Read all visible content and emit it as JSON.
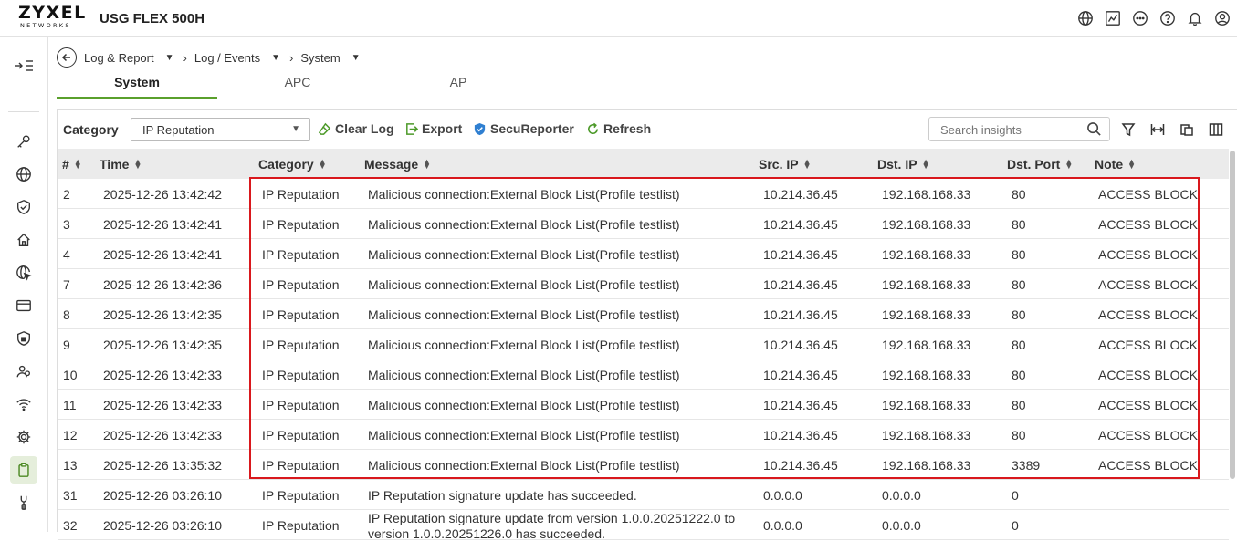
{
  "app": {
    "logo_main": "ZYXEL",
    "logo_sub": "NETWORKS",
    "device_name": "USG FLEX 500H"
  },
  "top_icons": [
    "globe-icon",
    "chart-icon",
    "more-icon",
    "help-icon",
    "bell-icon",
    "user-icon"
  ],
  "sidebar": {
    "items": [
      "key-icon",
      "globe-icon",
      "shield-check-icon",
      "cloud-home-icon",
      "globe-cursor-icon",
      "card-icon",
      "shield-lock-icon",
      "users-icon",
      "wifi-icon",
      "gear-icon",
      "clipboard-icon",
      "wrench-icon"
    ],
    "active": "clipboard-icon"
  },
  "breadcrumb": {
    "items": [
      "Log & Report",
      "Log / Events",
      "System"
    ]
  },
  "tabs": [
    {
      "label": "System",
      "active": true
    },
    {
      "label": "APC",
      "active": false
    },
    {
      "label": "AP",
      "active": false
    }
  ],
  "toolbar": {
    "category_label": "Category",
    "category_value": "IP Reputation",
    "clear_log": "Clear Log",
    "export": "Export",
    "secureporter": "SecuReporter",
    "refresh": "Refresh",
    "search_placeholder": "Search insights",
    "accent_color": "#5aa02c"
  },
  "table": {
    "headers": [
      "#",
      "Time",
      "Category",
      "Message",
      "Src. IP",
      "Dst. IP",
      "Dst. Port",
      "Note"
    ],
    "rows": [
      [
        "2",
        "2025-12-26 13:42:42",
        "IP Reputation",
        "Malicious connection:External Block List(Profile testlist)",
        "10.214.36.45",
        "192.168.168.33",
        "80",
        "ACCESS BLOCK"
      ],
      [
        "3",
        "2025-12-26 13:42:41",
        "IP Reputation",
        "Malicious connection:External Block List(Profile testlist)",
        "10.214.36.45",
        "192.168.168.33",
        "80",
        "ACCESS BLOCK"
      ],
      [
        "4",
        "2025-12-26 13:42:41",
        "IP Reputation",
        "Malicious connection:External Block List(Profile testlist)",
        "10.214.36.45",
        "192.168.168.33",
        "80",
        "ACCESS BLOCK"
      ],
      [
        "7",
        "2025-12-26 13:42:36",
        "IP Reputation",
        "Malicious connection:External Block List(Profile testlist)",
        "10.214.36.45",
        "192.168.168.33",
        "80",
        "ACCESS BLOCK"
      ],
      [
        "8",
        "2025-12-26 13:42:35",
        "IP Reputation",
        "Malicious connection:External Block List(Profile testlist)",
        "10.214.36.45",
        "192.168.168.33",
        "80",
        "ACCESS BLOCK"
      ],
      [
        "9",
        "2025-12-26 13:42:35",
        "IP Reputation",
        "Malicious connection:External Block List(Profile testlist)",
        "10.214.36.45",
        "192.168.168.33",
        "80",
        "ACCESS BLOCK"
      ],
      [
        "10",
        "2025-12-26 13:42:33",
        "IP Reputation",
        "Malicious connection:External Block List(Profile testlist)",
        "10.214.36.45",
        "192.168.168.33",
        "80",
        "ACCESS BLOCK"
      ],
      [
        "11",
        "2025-12-26 13:42:33",
        "IP Reputation",
        "Malicious connection:External Block List(Profile testlist)",
        "10.214.36.45",
        "192.168.168.33",
        "80",
        "ACCESS BLOCK"
      ],
      [
        "12",
        "2025-12-26 13:42:33",
        "IP Reputation",
        "Malicious connection:External Block List(Profile testlist)",
        "10.214.36.45",
        "192.168.168.33",
        "80",
        "ACCESS BLOCK"
      ],
      [
        "13",
        "2025-12-26 13:35:32",
        "IP Reputation",
        "Malicious connection:External Block List(Profile testlist)",
        "10.214.36.45",
        "192.168.168.33",
        "3389",
        "ACCESS BLOCK"
      ],
      [
        "31",
        "2025-12-26 03:26:10",
        "IP Reputation",
        "IP Reputation signature update has succeeded.",
        "0.0.0.0",
        "0.0.0.0",
        "0",
        ""
      ],
      [
        "32",
        "2025-12-26 03:26:10",
        "IP Reputation",
        "IP Reputation signature update from version 1.0.0.20251222.0 to version 1.0.0.20251226.0 has succeeded.",
        "0.0.0.0",
        "0.0.0.0",
        "0",
        ""
      ]
    ]
  },
  "highlight_color": "#d9181d"
}
